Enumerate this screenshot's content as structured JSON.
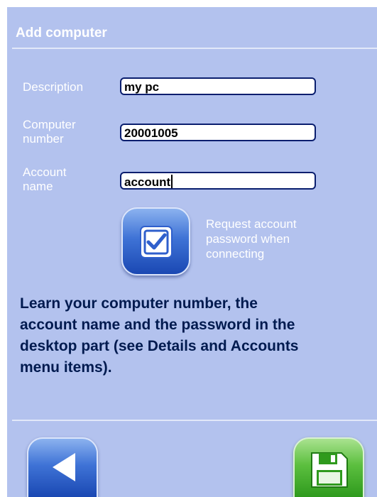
{
  "header": {
    "title": "Add computer"
  },
  "form": {
    "description": {
      "label": "Description",
      "value": "my pc"
    },
    "computer_number": {
      "label_line1": "Computer",
      "label_line2": "number",
      "value": "20001005"
    },
    "account_name": {
      "label_line1": "Account",
      "label_line2": "name",
      "value": "account"
    },
    "request_password": {
      "checked": true,
      "line1": "Request account",
      "line2": "password when",
      "line3": "connecting"
    }
  },
  "info": {
    "line1": "Learn your computer number, the",
    "line2": "account name and the password in the",
    "line3": "desktop part (see Details and Accounts",
    "line4": "menu items)."
  },
  "footer": {
    "back_icon": "back-arrow-icon",
    "save_icon": "floppy-disk-icon"
  },
  "colors": {
    "panel": "#b3c2ee",
    "info_text": "#001a4f",
    "button_blue": "#2f5fcc",
    "button_green": "#4fb535"
  }
}
